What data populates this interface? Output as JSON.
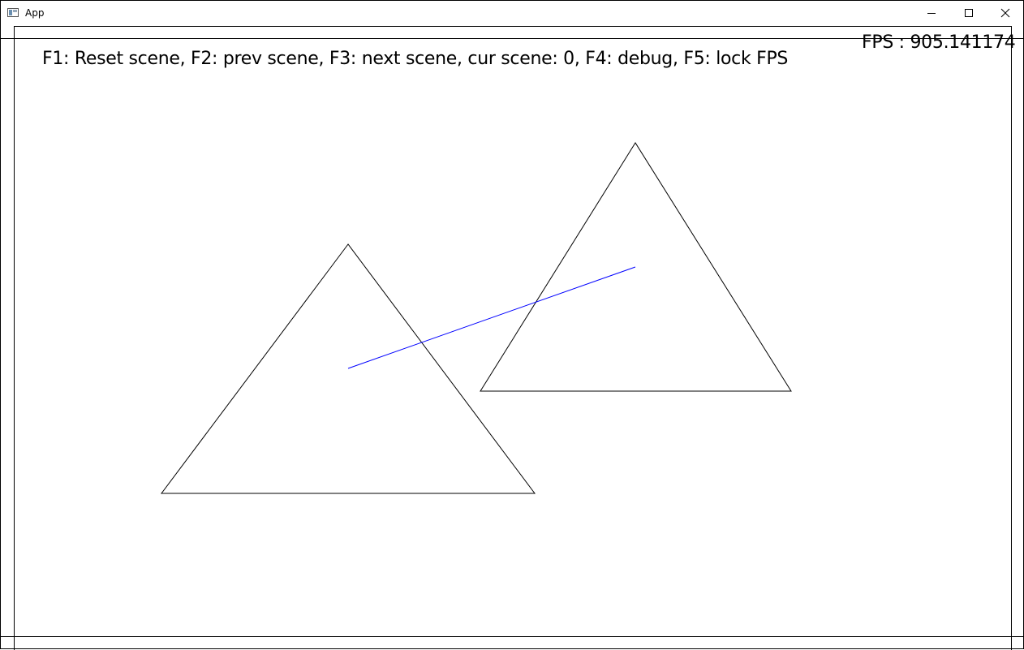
{
  "window": {
    "title": "App",
    "controls": {
      "minimize_icon": "minimize-icon",
      "maximize_icon": "maximize-icon",
      "close_icon": "close-icon"
    }
  },
  "overlay": {
    "help": "F1: Reset scene, F2: prev scene, F3: next scene, cur scene: 0, F4: debug, F5: lock FPS",
    "fps": "FPS : 905.141174"
  },
  "scene": {
    "current_scene": 0,
    "colors": {
      "background": "#ffffff",
      "outline": "#000000",
      "connector": "#0000ff"
    }
  }
}
